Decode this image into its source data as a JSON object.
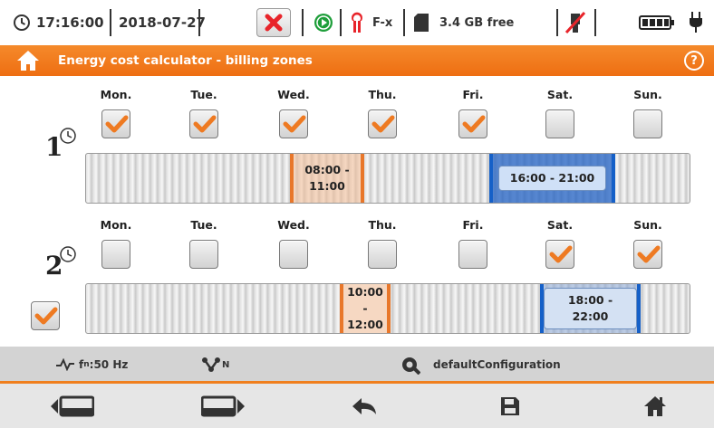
{
  "status": {
    "time": "17:16:00",
    "date": "2018-07-27",
    "clamp_label": "F-x",
    "memory_free": "3.4 GB free"
  },
  "header": {
    "title": "Energy cost calculator - billing zones"
  },
  "zones": [
    {
      "days": [
        {
          "label": "Mon.",
          "checked": true
        },
        {
          "label": "Tue.",
          "checked": true
        },
        {
          "label": "Wed.",
          "checked": true
        },
        {
          "label": "Thu.",
          "checked": true
        },
        {
          "label": "Fri.",
          "checked": true
        },
        {
          "label": "Sat.",
          "checked": false
        },
        {
          "label": "Sun.",
          "checked": false
        }
      ],
      "ranges": [
        {
          "label_line1": "08:00 -",
          "label_line2": "11:00",
          "style": "orange"
        },
        {
          "label": "16:00 - 21:00",
          "style": "blue"
        }
      ]
    },
    {
      "enabled": true,
      "days": [
        {
          "label": "Mon.",
          "checked": false
        },
        {
          "label": "Tue.",
          "checked": false
        },
        {
          "label": "Wed.",
          "checked": false
        },
        {
          "label": "Thu.",
          "checked": false
        },
        {
          "label": "Fri.",
          "checked": false
        },
        {
          "label": "Sat.",
          "checked": true
        },
        {
          "label": "Sun.",
          "checked": true
        }
      ],
      "ranges": [
        {
          "label_line1": "10:00 -",
          "label_line2": "12:00",
          "style": "orange"
        },
        {
          "label": "18:00 - 22:00",
          "style": "blue-light"
        }
      ]
    }
  ],
  "info": {
    "frequency_prefix": "f",
    "frequency_sub": "n",
    "frequency_suffix": ":50 Hz",
    "network_sub": "N",
    "config_name": "defaultConfiguration"
  },
  "colors": {
    "accent": "#f07f1e",
    "check": "#ee7a22",
    "close_button": "#e8242a",
    "selection_blue": "#1560c8"
  },
  "icons": {
    "toolbar": [
      "screen-prev-icon",
      "screen-next-icon",
      "back-arrow-icon",
      "save-icon",
      "home-icon"
    ]
  }
}
